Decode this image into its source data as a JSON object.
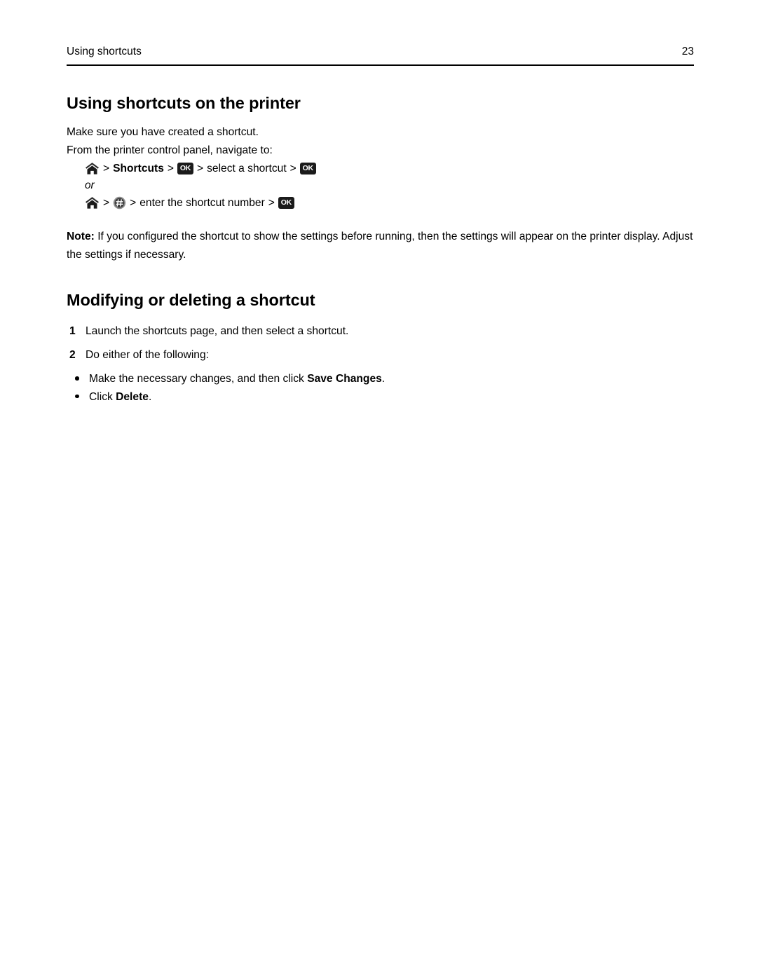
{
  "document": {
    "running_header": {
      "title": "Using shortcuts",
      "page_number": "23"
    },
    "sections": [
      {
        "heading": "Using shortcuts on the printer",
        "intro": "Make sure you have created a shortcut.",
        "navigate_intro": "From the printer control panel, navigate to:",
        "nav_path_1": {
          "home_icon": "home-icon",
          "separator": ">",
          "shortcuts_label": "Shortcuts",
          "ok_icon": "ok-button-icon",
          "select_label": "select a shortcut",
          "ok_icon_2": "ok-button-icon"
        },
        "or_label": "or",
        "nav_path_2": {
          "home_icon": "home-icon",
          "separator": ">",
          "hash_icon": "hash-button-icon",
          "enter_label": "enter the shortcut number",
          "ok_icon": "ok-button-icon"
        },
        "note": {
          "label": "Note:",
          "text": "If you configured the shortcut to show the settings before running, then the settings will appear on the printer display. Adjust the settings if necessary."
        }
      },
      {
        "heading": "Modifying or deleting a shortcut",
        "steps": [
          {
            "number": "1",
            "text": "Launch the shortcuts page, and then select a shortcut."
          },
          {
            "number": "2",
            "text": "Do either of the following:"
          }
        ],
        "bullets": [
          {
            "text_before": "Make the necessary changes, and then click ",
            "bold": "Save Changes",
            "text_after": "."
          },
          {
            "text_before": "Click ",
            "bold": "Delete",
            "text_after": "."
          }
        ]
      }
    ],
    "icons": {
      "ok_label": "OK",
      "hash_label": "#"
    },
    "colors": {
      "text": "#000000",
      "background": "#ffffff",
      "icon_dark": "#1b1b1b"
    }
  }
}
